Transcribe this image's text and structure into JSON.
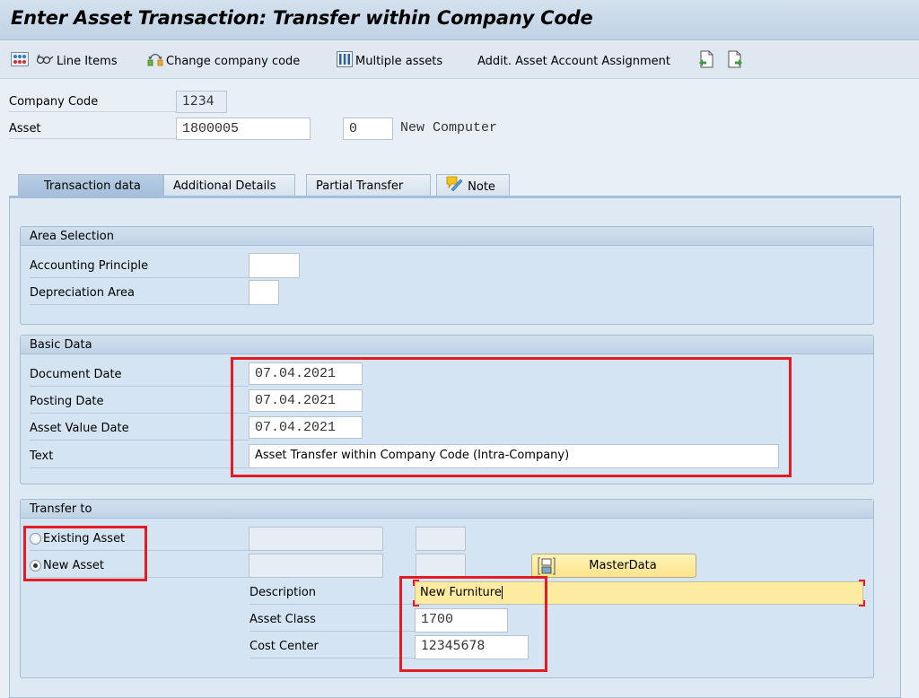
{
  "window": {
    "title": "Enter Asset Transaction: Transfer within Company Code"
  },
  "toolbar": {
    "items": [
      {
        "id": "line-items",
        "label": "Line Items",
        "icon": "glasses-icon"
      },
      {
        "id": "change-company-code",
        "label": "Change company code",
        "icon": "change-company-code-icon"
      },
      {
        "id": "multiple-assets",
        "label": "Multiple assets",
        "icon": "multiple-assets-icon"
      },
      {
        "id": "addit-asset-account-assignment",
        "label": "Addit. Asset Account Assignment"
      }
    ],
    "overview_icon": "overview-tree-icon",
    "prev_icon": "previous-document-icon",
    "next_icon": "next-document-icon"
  },
  "header": {
    "company_code": {
      "label": "Company Code",
      "value": "1234"
    },
    "asset": {
      "label": "Asset",
      "value": "1800005",
      "subnumber": "0",
      "description": "New Computer"
    }
  },
  "tabs": [
    {
      "label": "Transaction data",
      "active": true
    },
    {
      "label": "Additional Details",
      "active": false
    },
    {
      "label": "Partial Transfer",
      "active": false
    },
    {
      "label": "Note",
      "active": false,
      "icon": "note-pencil-icon"
    }
  ],
  "area_selection": {
    "title": "Area Selection",
    "accounting_principle": {
      "label": "Accounting Principle",
      "value": ""
    },
    "depreciation_area": {
      "label": "Depreciation Area",
      "value": ""
    }
  },
  "basic_data": {
    "title": "Basic Data",
    "document_date": {
      "label": "Document Date",
      "value": "07.04.2021"
    },
    "posting_date": {
      "label": "Posting Date",
      "value": "07.04.2021"
    },
    "asset_value_date": {
      "label": "Asset Value Date",
      "value": "07.04.2021"
    },
    "text": {
      "label": "Text",
      "value": "Asset Transfer within Company Code (Intra-Company)"
    }
  },
  "transfer_to": {
    "title": "Transfer to",
    "existing_asset": {
      "label": "Existing Asset",
      "selected": false,
      "value": "",
      "subnumber": ""
    },
    "new_asset": {
      "label": "New Asset",
      "selected": true,
      "value": "",
      "subnumber": ""
    },
    "master_data_button": "MasterData",
    "description": {
      "label": "Description",
      "value": "New Furniture"
    },
    "asset_class": {
      "label": "Asset Class",
      "value": "1700"
    },
    "cost_center": {
      "label": "Cost Center",
      "value": "12345678"
    }
  },
  "colors": {
    "highlight_box": "#e31b23",
    "focused_field": "#fdeca0",
    "master_data_button": "#fbe48c"
  }
}
